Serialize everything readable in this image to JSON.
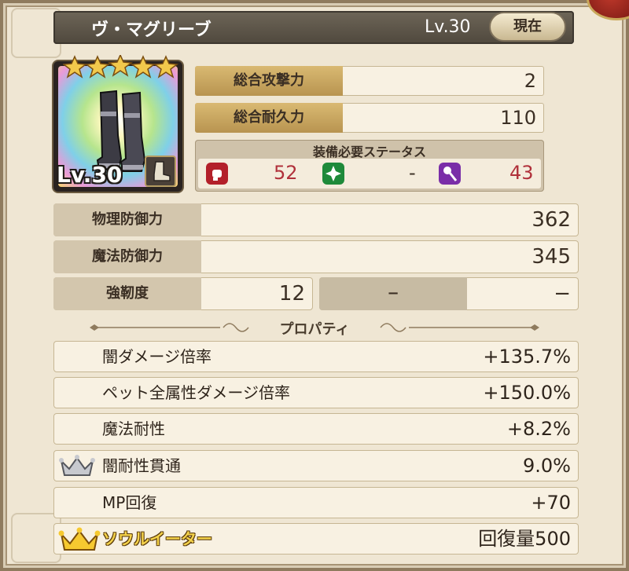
{
  "item": {
    "name": "ヴ・マグリーブ",
    "level_label": "Lv.30",
    "current_label": "現在",
    "rarity_stars": 5
  },
  "portrait": {
    "level_badge": "Lv.30",
    "slot_icon": "boot-icon"
  },
  "attack": {
    "label": "総合攻撃力",
    "value": "2"
  },
  "durability": {
    "label": "総合耐久力",
    "value": "110"
  },
  "requirements": {
    "title": "装備必要ステータス",
    "items": [
      {
        "icon": "strength-icon",
        "color": "#b3202a",
        "value": "52"
      },
      {
        "icon": "dexterity-icon",
        "color": "#1e8a3a",
        "value": "-"
      },
      {
        "icon": "magic-icon",
        "color": "#7a2ea8",
        "value": "43"
      }
    ]
  },
  "stats": {
    "physical_defense": {
      "label": "物理防御力",
      "value": "362"
    },
    "magic_defense": {
      "label": "魔法防御力",
      "value": "345"
    },
    "toughness": {
      "label": "強靭度",
      "value": "12"
    },
    "empty_slot": {
      "label": "−",
      "value": "−"
    }
  },
  "properties_title": "プロパティ",
  "properties": [
    {
      "label": "闇ダメージ倍率",
      "value": "+135.7%"
    },
    {
      "label": "ペット全属性ダメージ倍率",
      "value": "+150.0%"
    },
    {
      "label": "魔法耐性",
      "value": "+8.2%"
    },
    {
      "label": "闇耐性貫通",
      "value": "9.0%",
      "crown": "silver"
    },
    {
      "label": "MP回復",
      "value": "+70"
    },
    {
      "label": "ソウルイーター",
      "value": "回復量500",
      "crown": "gold"
    }
  ]
}
